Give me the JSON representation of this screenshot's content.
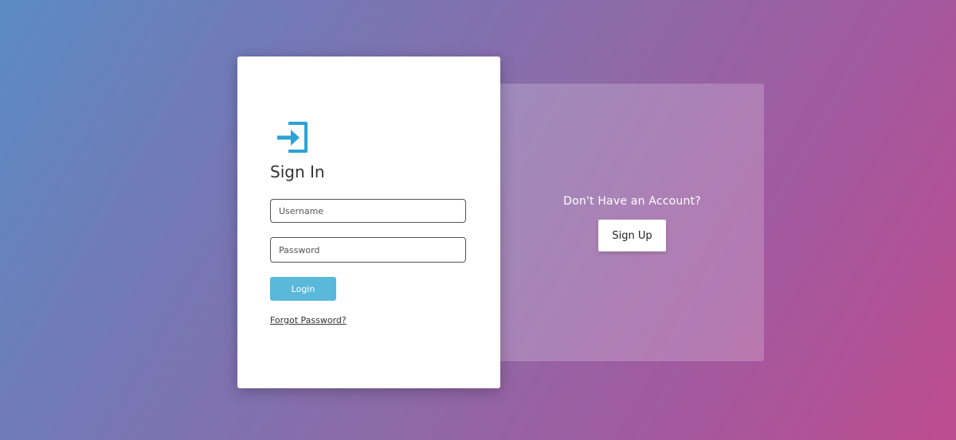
{
  "login": {
    "heading": "Sign In",
    "icon": "login-arrow-icon",
    "username_placeholder": "Username",
    "password_placeholder": "Password",
    "login_label": "Login",
    "forgot_label": "Forgot Password?",
    "accent_color": "#5ab9db"
  },
  "signup": {
    "title": "Don't Have an Account?",
    "button_label": "Sign Up"
  }
}
